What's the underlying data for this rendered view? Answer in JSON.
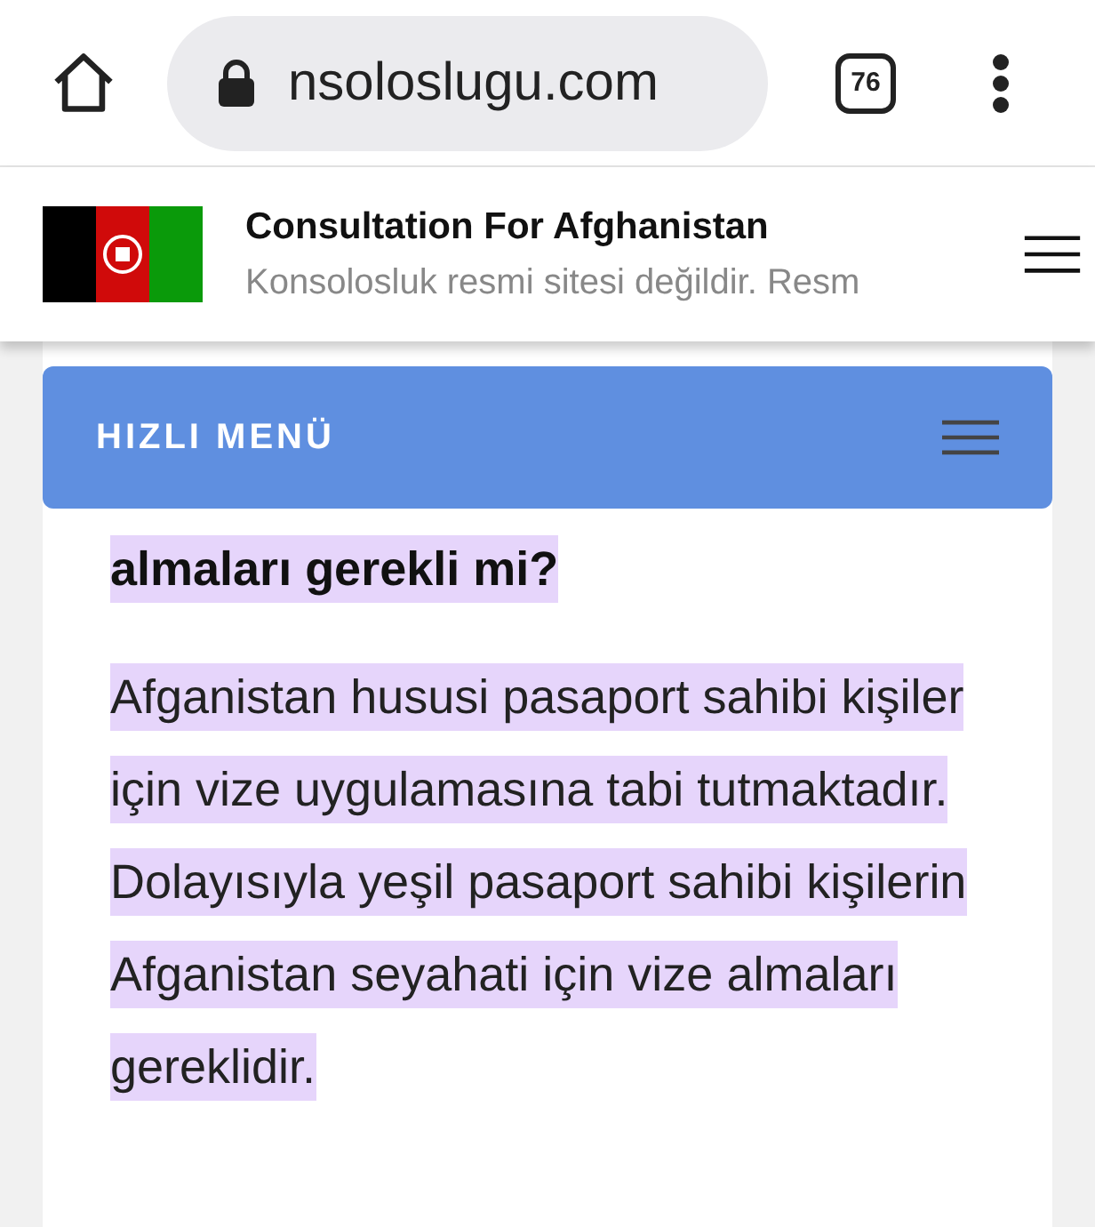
{
  "browser": {
    "url": "nsoloslugu.com",
    "tab_count": "76"
  },
  "header": {
    "title": "Consultation For Afghanistan",
    "subtitle": "Konsolosluk resmi sitesi değildir. Resm"
  },
  "quick_menu": {
    "label": "HIZLI MENÜ"
  },
  "article": {
    "heading": "almaları gerekli mi?",
    "paragraph": "Afganistan hususi pasaport sahibi kişiler için vize uygulamasına tabi tutmaktadır. Dolayısıyla yeşil pasaport sahibi kişilerin Afganistan seyahati için vize almaları gereklidir."
  }
}
